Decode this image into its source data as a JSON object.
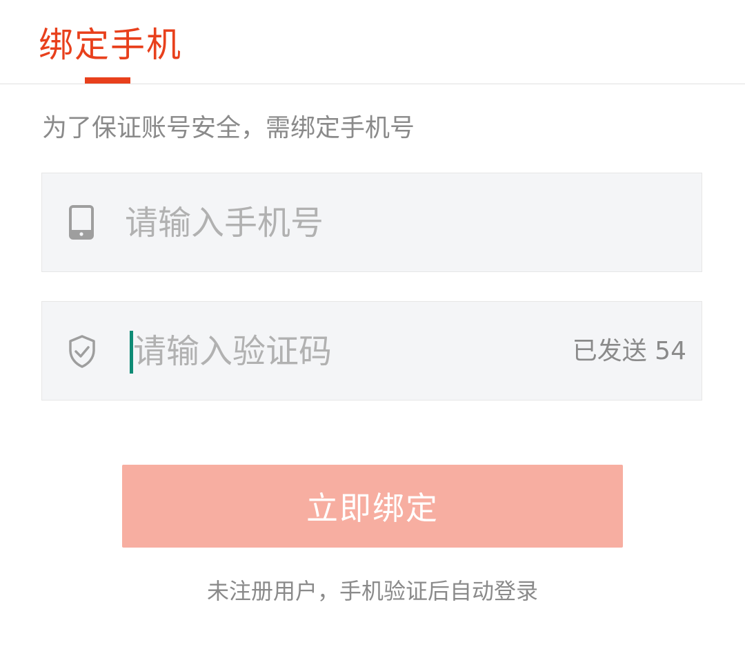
{
  "colors": {
    "brand_red": "#e8401c",
    "button_bg": "#f7aea1",
    "caret": "#0e8b75",
    "icon_gray": "#9e9e9e",
    "field_bg": "#f4f5f7"
  },
  "header": {
    "tab_title": "绑定手机"
  },
  "hint": "为了保证账号安全，需绑定手机号",
  "phone_field": {
    "icon": "mobile-phone-icon",
    "placeholder": "请输入手机号",
    "value": ""
  },
  "code_field": {
    "icon": "shield-check-icon",
    "placeholder": "请输入验证码",
    "value": "",
    "countdown_label": "已发送 54"
  },
  "bind_button_label": "立即绑定",
  "footer_note": "未注册用户，手机验证后自动登录"
}
